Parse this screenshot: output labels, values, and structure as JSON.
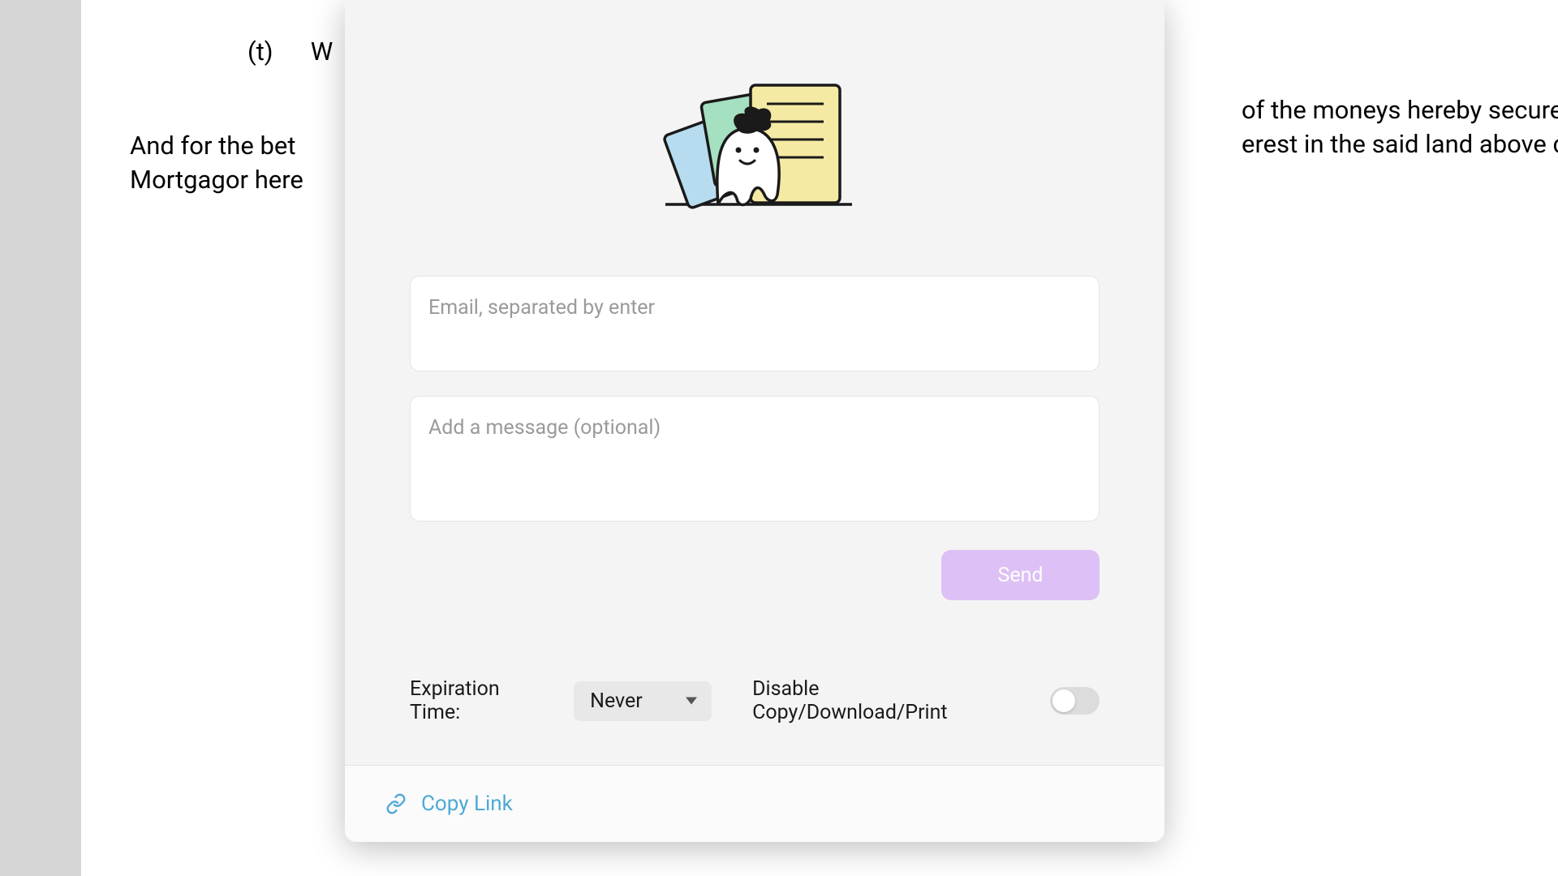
{
  "document": {
    "clause_marker": "(t)",
    "clause_start": "W",
    "paragraph_left": "And for the bet\nMortgagor here",
    "paragraph_right": "of the moneys hereby secured, t\nerest in the said land above desc"
  },
  "modal": {
    "email_placeholder": "Email, separated by enter",
    "message_placeholder": "Add a message (optional)",
    "send_label": "Send",
    "expiration_label": "Expiration Time:",
    "expiration_value": "Never",
    "disable_label": "Disable Copy/Download/Print",
    "copy_link_label": "Copy Link",
    "toggle_state": "off"
  }
}
